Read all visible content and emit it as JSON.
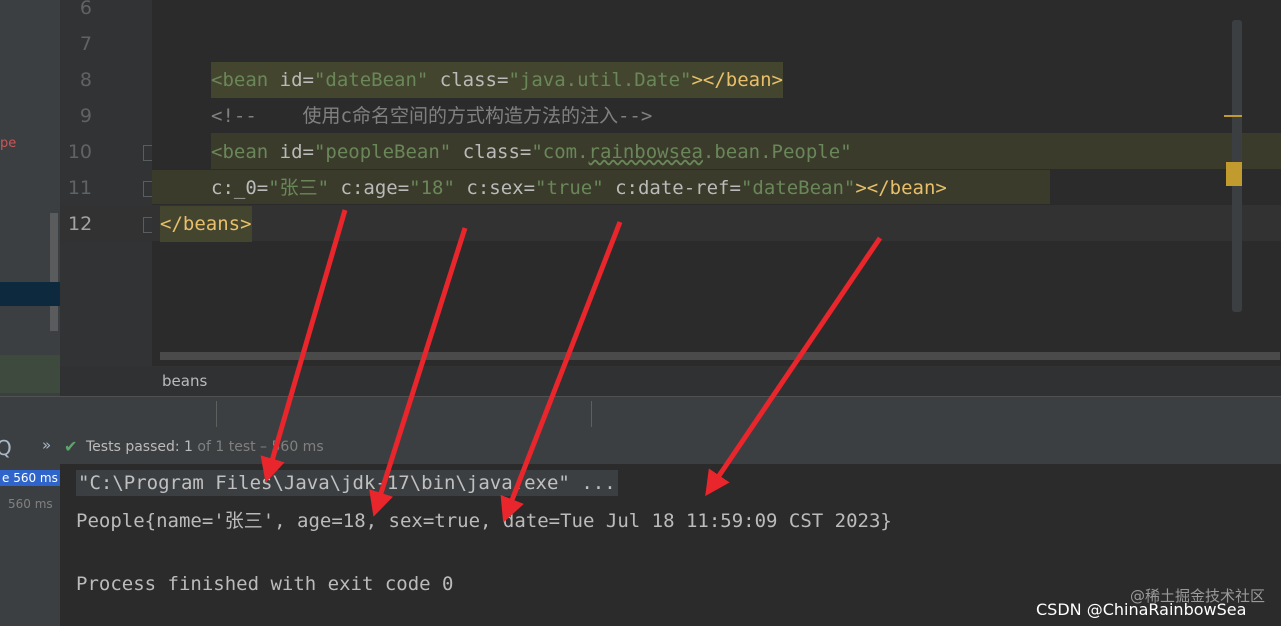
{
  "left_panel": {
    "fragment": "pe",
    "q_glyph": "Q",
    "test_time_selected": "e 560 ms",
    "test_time": "560 ms"
  },
  "gutter": {
    "line_numbers": [
      "6",
      "7",
      "8",
      "9",
      "10",
      "11",
      "12"
    ]
  },
  "editor": {
    "line8": {
      "open": "<bean ",
      "attr1": "id=",
      "val1": "\"dateBean\"",
      "attr2": " class=",
      "val2": "\"java.util.Date\"",
      "close": "></bean>"
    },
    "line9": {
      "comment": "<!--    使用c命名空间的方式构造方法的注入-->"
    },
    "line10": {
      "open": "<bean ",
      "attr1": "id=",
      "val1": "\"peopleBean\"",
      "attr2": " class=",
      "val2a": "\"com.",
      "val2b": "rainbowsea",
      "val2c": ".bean.People\""
    },
    "line11": {
      "a1": "c:_0=",
      "v1": "\"张三\"",
      "a2": " c:age=",
      "v2": "\"18\"",
      "a3": " c:sex=",
      "v3": "\"true\"",
      "a4": " c:date-ref=",
      "v4": "\"dateBean\"",
      "close": "></bean>"
    },
    "line12": {
      "close": "</beans>"
    }
  },
  "breadcrumb": {
    "item": "beans"
  },
  "tests_bar": {
    "chevron": "»",
    "check_icon": "✔",
    "label": "Tests passed: ",
    "count": "1",
    "detail": " of 1 test – 560 ms"
  },
  "console": {
    "cmd": "\"C:\\Program Files\\Java\\jdk-17\\bin\\java.exe\" ...",
    "output": "People{name='张三', age=18, sex=true, date=Tue Jul 18 11:59:09 CST 2023}",
    "exit": "Process finished with exit code 0"
  },
  "watermarks": {
    "juejin": "@稀土掘金技术社区",
    "csdn": "CSDN @ChinaRainbowSea"
  },
  "colors": {
    "arrow": "#e8262c",
    "tag": "#e8bf6a",
    "value": "#6a8759",
    "success": "#59a869"
  }
}
